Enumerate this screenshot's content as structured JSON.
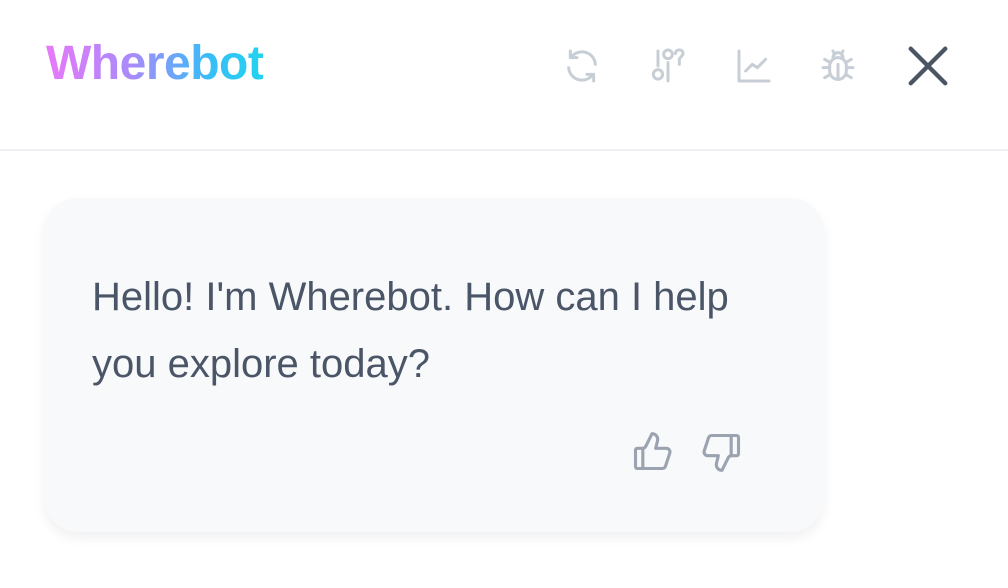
{
  "header": {
    "brand_title": "Wherebot",
    "icons": {
      "refresh": "refresh-icon",
      "settings": "sliders-icon",
      "analytics": "line-chart-icon",
      "debug": "bug-icon",
      "close": "close-icon"
    }
  },
  "message": {
    "text": "Hello! I'm Wherebot. How can I help you explore today?",
    "feedback": {
      "like_icon": "thumbs-up-icon",
      "dislike_icon": "thumbs-down-icon"
    }
  },
  "colors": {
    "brand_gradient_start": "#e879f9",
    "brand_gradient_end": "#22d3ee",
    "icon_muted": "#c8ced6",
    "icon_dark": "#4b5563",
    "message_text": "#4a5567",
    "bubble_bg": "#f8f9fb"
  }
}
